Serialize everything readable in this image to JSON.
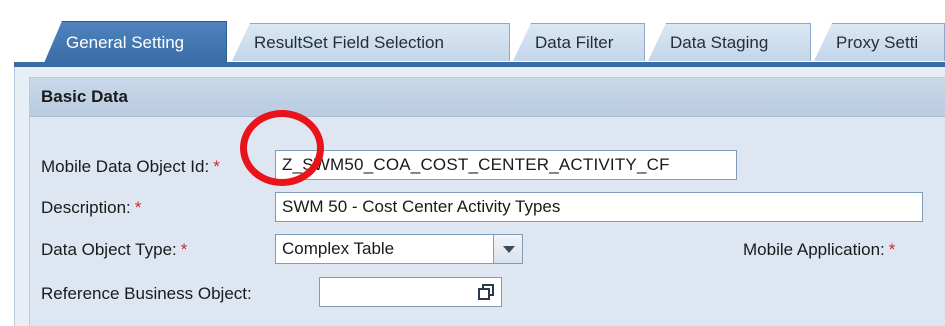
{
  "tabs": [
    {
      "label": "General Setting",
      "active": true
    },
    {
      "label": "ResultSet Field Selection",
      "active": false
    },
    {
      "label": "Data Filter",
      "active": false
    },
    {
      "label": "Data Staging",
      "active": false
    },
    {
      "label": "Proxy Setti",
      "active": false
    }
  ],
  "section": {
    "title": "Basic Data"
  },
  "form": {
    "mobile_data_object_id": {
      "label": "Mobile Data Object Id:",
      "required_mark": "*",
      "value": "Z_SWM50_COA_COST_CENTER_ACTIVITY_CF"
    },
    "description": {
      "label": "Description:",
      "required_mark": "*",
      "value": "SWM 50 - Cost Center Activity Types"
    },
    "data_object_type": {
      "label": "Data Object Type:",
      "required_mark": "*",
      "value": "Complex Table"
    },
    "mobile_application": {
      "label": "Mobile Application:",
      "required_mark": "*"
    },
    "reference_business_object": {
      "label": "Reference Business Object:",
      "value": ""
    }
  },
  "icons": {
    "dropdown": "chevron-down-icon",
    "value_help": "value-help-icon"
  },
  "colors": {
    "active_tab": "#3a6da6",
    "panel_background": "#dde6f1",
    "required_mark": "#d22a2a",
    "annotation_circle": "#e8141a"
  }
}
